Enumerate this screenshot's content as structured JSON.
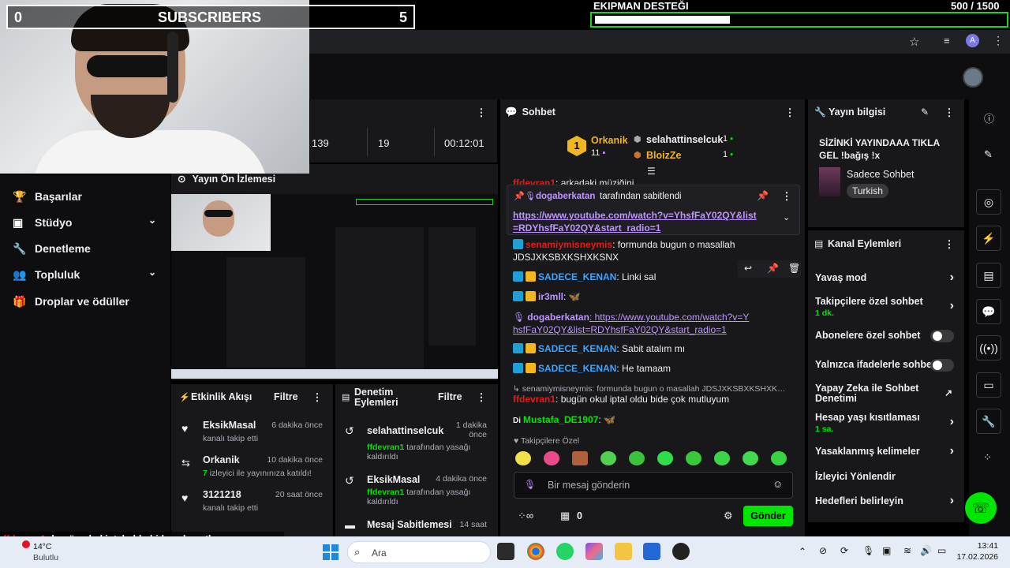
{
  "overlay": {
    "sub_count_left": "0",
    "sub_label": "SUBSCRIBERS",
    "sub_count_right": "5",
    "goal_title": "EKIPMAN DESTEĞI",
    "goal_value": "500 / 1500",
    "goal_progress": 0.333
  },
  "stats": {
    "viewers": "139",
    "followers": "19",
    "uptime": "00:12:01"
  },
  "sidebar": {
    "items": [
      {
        "label": "Başarılar",
        "icon": "trophy-icon"
      },
      {
        "label": "Stüdyo",
        "icon": "studio-icon",
        "expandable": true
      },
      {
        "label": "Denetleme",
        "icon": "wrench-icon"
      },
      {
        "label": "Topluluk",
        "icon": "community-icon",
        "expandable": true
      },
      {
        "label": "Droplar ve ödüller",
        "icon": "gift-icon"
      }
    ]
  },
  "preview": {
    "title": "Yayın Ön İzlemesi"
  },
  "activity": {
    "title": "Etkinlik Akışı",
    "filter": "Filtre",
    "items": [
      {
        "name": "EksikMasal",
        "time": "6 dakika önce",
        "desc_pre": "",
        "desc_hl": "",
        "desc": "kanalı takip etti",
        "icon": "heart-icon"
      },
      {
        "name": "Orkanik",
        "time": "10 dakika önce",
        "desc_pre": "",
        "desc_hl": "7",
        "desc": " izleyici ile yayınınıza katıldı!",
        "icon": "raid-icon"
      },
      {
        "name": "3121218",
        "time": "20 saat önce",
        "desc_pre": "",
        "desc_hl": "",
        "desc": "kanalı takip etti",
        "icon": "heart-icon"
      }
    ]
  },
  "modlog": {
    "title": "Denetim Eylemleri",
    "filter": "Filtre",
    "items": [
      {
        "name": "selahattinselcuk",
        "time": "1 dakika önce",
        "actor": "ffdevran1",
        "desc": " tarafından yasağı kaldırıldı"
      },
      {
        "name": "EksikMasal",
        "time": "4 dakika önce",
        "actor": "ffdevran1",
        "desc": " tarafından yasağı kaldırıldı"
      },
      {
        "name": "Mesaj Sabitlemesi",
        "time": "14 saat",
        "actor": "",
        "desc": ""
      }
    ]
  },
  "chat": {
    "title": "Sohbet",
    "leader_1": "Orkanik",
    "leader_1_count": "11",
    "leader_2": "selahattinselcuk",
    "leader_2_count": "1",
    "leader_3": "BloizZe",
    "leader_3_count": "1",
    "pinned_by": "dogaberkatan",
    "pinned_suffix": "tarafından sabitlendi",
    "pinned_link": "https://www.youtube.com/watch?v=YhsfFaY02QY&list=RDYhsfFaY02QY&start_radio=1",
    "partial_top_user": "ffdevran1",
    "partial_top_text": ": arkadaki müziğini",
    "messages": [
      {
        "user": "senamiymisneymis",
        "color": "#e91916",
        "text": ": formunda bugun o masallah JDSJXKSBXKSHXKSNX",
        "badges": [
          "mod"
        ]
      },
      {
        "user": "SADECE_KENAN",
        "color": "#3da5ff",
        "text": ": Linki sal",
        "badges": [
          "mod",
          "crown"
        ]
      },
      {
        "user": "ir3mll",
        "color": "#bf94ff",
        "text": ": 🦋",
        "badges": [
          "mod",
          "crown"
        ]
      },
      {
        "user": "dogaberkatan",
        "color": "#bf94ff",
        "text": ": https://www.youtube.com/watch?v=YhsfFaY02QY&list=RDYhsfFaY02QY&start_radio=1",
        "badges": [
          "mic"
        ]
      },
      {
        "user": "SADECE_KENAN",
        "color": "#3da5ff",
        "text": ": Sabit atalım mı",
        "badges": [
          "mod",
          "crown"
        ]
      },
      {
        "user": "SADECE_KENAN",
        "color": "#3da5ff",
        "text": ": He tamaam",
        "badges": [
          "mod",
          "crown"
        ]
      },
      {
        "user": "ffdevran1",
        "color": "#e91916",
        "text": ": bugün okul iptal oldu bide çok mutluyum",
        "badges": []
      },
      {
        "user": "Mustafa_DE1907",
        "color": "#00e600",
        "text": ": 🦋",
        "badges": [
          "di"
        ]
      }
    ],
    "reply_quote": "senamiymisneymis: formunda bugun o masallah JDSJXKSBXKSHXKSNX...",
    "followers_only": "Takipçilere Özel",
    "input_placeholder": "Bir mesaj gönderin",
    "points": "0",
    "send": "Gönder"
  },
  "streaminfo": {
    "title": "Yayın bilgisi",
    "stream_title": "SİZİNKİ YAYINDAAA TIKLA GEL !bağış !x",
    "category": "Sadece Sohbet",
    "tag": "Turkish"
  },
  "channel_actions": {
    "title": "Kanal Eylemleri",
    "items": [
      {
        "label": "Yavaş mod",
        "sub": "",
        "control": "arrow"
      },
      {
        "label": "Takipçilere özel sohbet",
        "sub": "1 dk.",
        "control": "arrow"
      },
      {
        "label": "Abonelere özel sohbet",
        "sub": "",
        "control": "toggle"
      },
      {
        "label": "Yalnızca ifadelerle sohbet",
        "sub": "",
        "control": "toggle"
      },
      {
        "label": "Yapay Zeka ile Sohbet Denetimi",
        "sub": "",
        "control": "external"
      },
      {
        "label": "Hesap yaşı kısıtlaması",
        "sub": "1 sa.",
        "control": "arrow"
      },
      {
        "label": "Yasaklanmış kelimeler",
        "sub": "",
        "control": "arrow"
      },
      {
        "label": "İzleyici Yönlendir",
        "sub": "",
        "control": "none"
      },
      {
        "label": "Hedefleri belirleyin",
        "sub": "",
        "control": "arrow"
      }
    ]
  },
  "ticker": {
    "user": "ffdevran1",
    "text": ": bugün okul iptal oldu bide çok mutluyum"
  },
  "taskbar": {
    "weather_temp": "14°C",
    "weather_desc": "Bulutlu",
    "search": "Ara",
    "time": "13:41",
    "date": "17.02.2026"
  },
  "colors": {
    "accent": "#9147ff",
    "send_button": "#00e600",
    "goal_border": "#19d32b",
    "panel": "#18181b"
  }
}
